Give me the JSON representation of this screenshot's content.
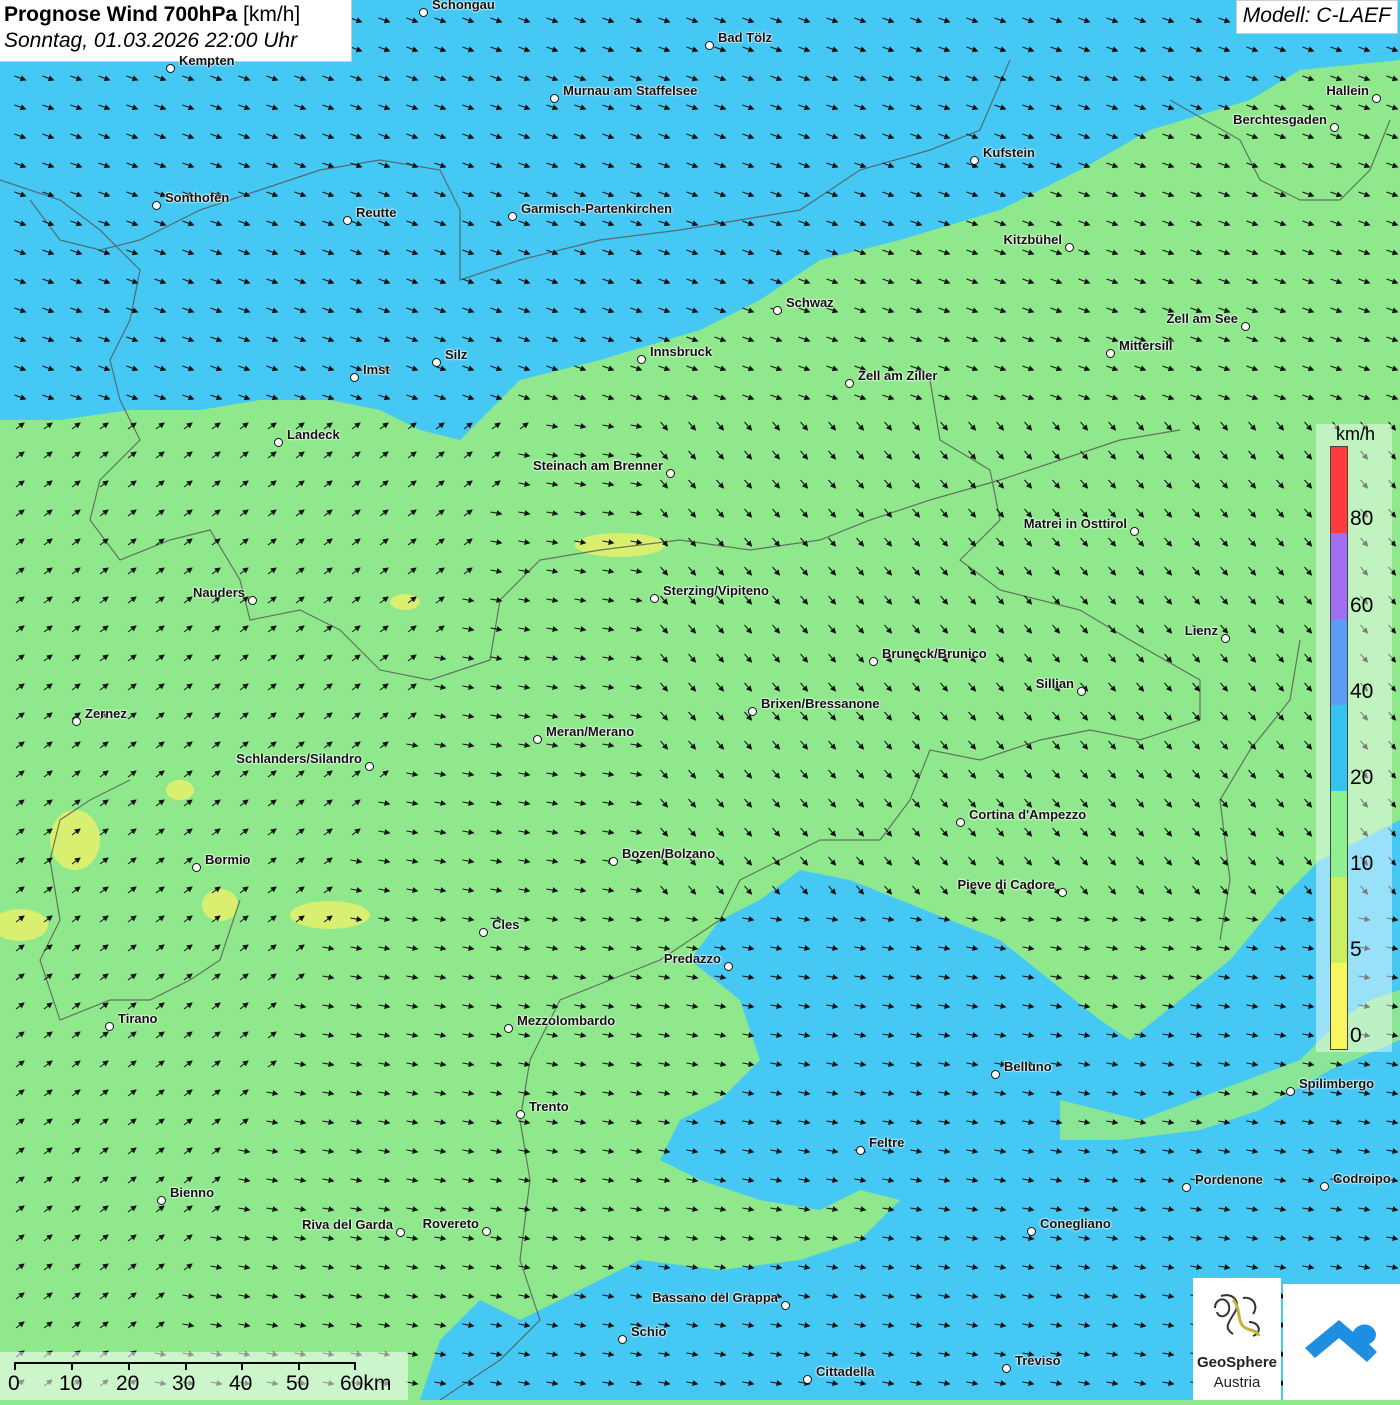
{
  "header": {
    "title_bold": "Prognose Wind 700hPa",
    "title_unit": "[km/h]",
    "datetime": "Sonntag, 01.03.2026 22:00 Uhr",
    "model": "Modell: C-LAEF"
  },
  "legend": {
    "unit": "km/h",
    "ticks": [
      "80",
      "60",
      "40",
      "20",
      "10",
      "5",
      "0"
    ],
    "colors": [
      "#ff3b3b",
      "#a06ef0",
      "#5a9df2",
      "#35c4f2",
      "#8ef08f",
      "#c8f060",
      "#f7f560"
    ]
  },
  "scale_bar": {
    "labels": [
      "0",
      "10",
      "20",
      "30",
      "40",
      "50",
      "60km"
    ]
  },
  "branding": {
    "name": "GeoSphere",
    "sub": "Austria"
  },
  "map_colors": {
    "green": "#8fe98c",
    "blue": "#45c8f3",
    "yellow": "#d8ef70"
  },
  "cities": [
    "Schongau",
    "Bad Tölz",
    "Kempten",
    "Murnau am Staffelsee",
    "Hallein",
    "Berchtesgaden",
    "Kufstein",
    "Sonthofen",
    "Reutte",
    "Garmisch-Partenkirchen",
    "Kitzbühel",
    "Schwaz",
    "Zell am See",
    "Mittersill",
    "Innsbruck",
    "Silz",
    "Imst",
    "Zell am Ziller",
    "Landeck",
    "Steinach am Brenner",
    "Matrei in Osttirol",
    "Nauders",
    "Sterzing/Vipiteno",
    "Lienz",
    "Bruneck/Brunico",
    "Sillian",
    "Brixen/Bressanone",
    "Zernez",
    "Meran/Merano",
    "Schlanders/Silandro",
    "Cortina d'Ampezzo",
    "Bozen/Bolzano",
    "Bormio",
    "Pieve di Cadore",
    "Cles",
    "Predazzo",
    "Tirano",
    "Mezzolombardo",
    "Belluno",
    "Spilimbergo",
    "Trento",
    "Feltre",
    "Pordenone",
    "Codroipo",
    "Bienno",
    "Riva del Garda",
    "Rovereto",
    "Conegliano",
    "Bassano del Grappa",
    "Schio",
    "Treviso",
    "Cittadella"
  ]
}
